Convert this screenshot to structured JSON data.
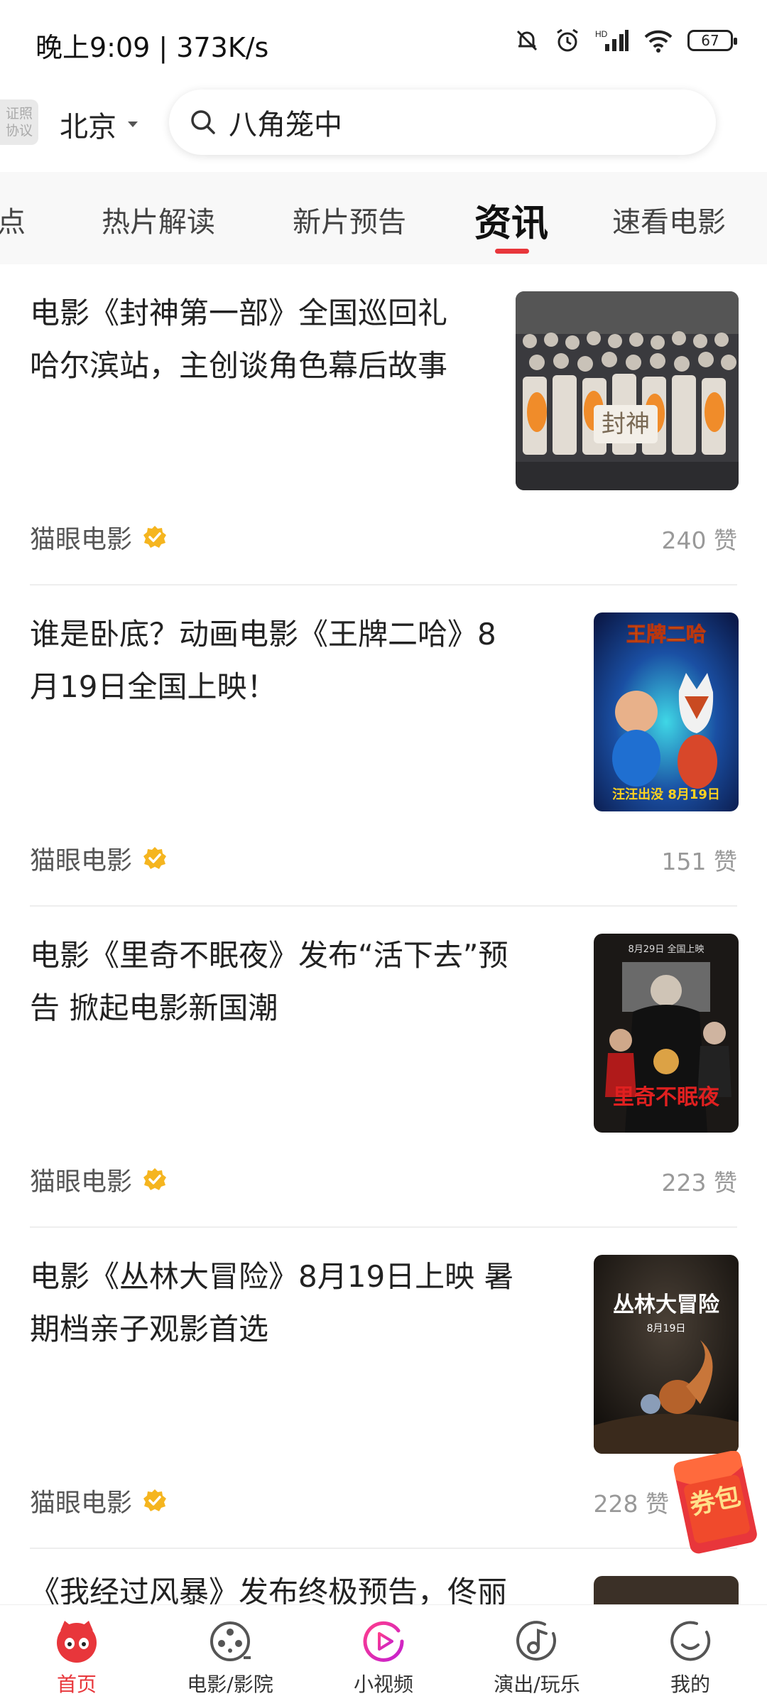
{
  "status_bar": {
    "text": "晚上9:09 | 373K/s",
    "battery": "67"
  },
  "header": {
    "license_badge": [
      "证照",
      "协议"
    ],
    "city": "北京",
    "search_placeholder": "八角笼中"
  },
  "tabs": [
    {
      "label": "点"
    },
    {
      "label": "热片解读"
    },
    {
      "label": "新片预告"
    },
    {
      "label": "资讯",
      "active": true
    },
    {
      "label": "速看电影"
    }
  ],
  "articles": [
    {
      "title_line1": "电影《封神第一部》全国巡回礼",
      "title_line2": "哈尔滨站，主创谈角色幕后故事",
      "source": "猫眼电影",
      "likes": "240 赞",
      "thumb_text": "封神"
    },
    {
      "title_line1": "谁是卧底？动画电影《王牌二哈》8",
      "title_line2": "月19日全国上映！",
      "source": "猫眼电影",
      "likes": "151 赞",
      "thumb_text": "王牌二哈",
      "thumb_sub": "汪汪出没 8月19日"
    },
    {
      "title_line1": "电影《里奇不眠夜》发布“活下去”预",
      "title_line2": "告 掀起电影新国潮",
      "source": "猫眼电影",
      "likes": "223 赞",
      "thumb_text": "里奇不眠夜",
      "thumb_sub": "8月29日 全国上映"
    },
    {
      "title_line1": "电影《丛林大冒险》8月19日上映 暑",
      "title_line2": "期档亲子观影首选",
      "source": "猫眼电影",
      "likes": "228 赞",
      "thumb_text": "丛林大冒险",
      "thumb_sub": "8月19日"
    },
    {
      "title_line1": "《我经过风暴》发布终极预告，佟丽",
      "title_line2": "",
      "source": "",
      "likes": ""
    }
  ],
  "coupon": "券包",
  "bottom_nav": [
    {
      "label": "首页",
      "icon": "cat-face-icon",
      "active": true
    },
    {
      "label": "电影/影院",
      "icon": "film-reel-icon"
    },
    {
      "label": "小视频",
      "icon": "play-circle-icon"
    },
    {
      "label": "演出/玩乐",
      "icon": "music-note-icon"
    },
    {
      "label": "我的",
      "icon": "profile-circle-icon"
    }
  ],
  "colors": {
    "accent": "#e8363b",
    "verified": "#f5b51f"
  }
}
